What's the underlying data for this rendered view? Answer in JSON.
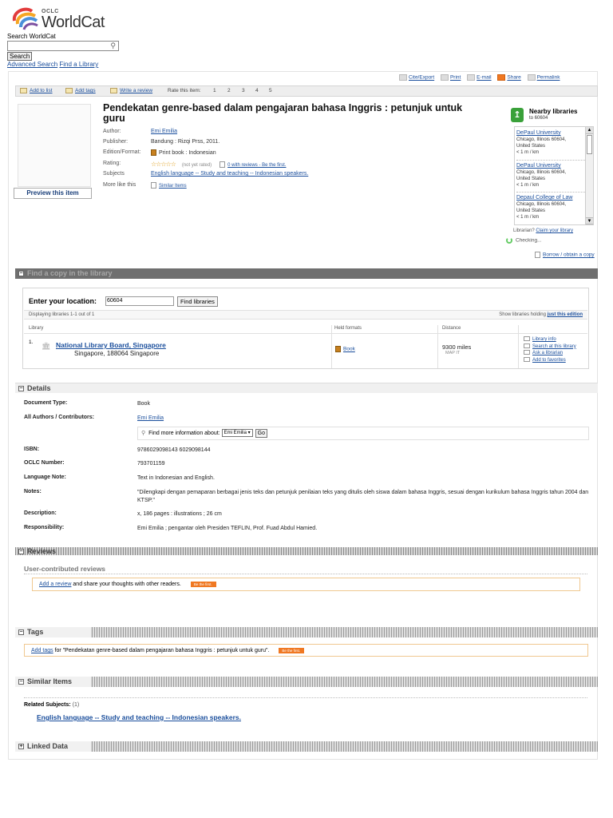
{
  "header": {
    "logo_oclc": "OCLC",
    "logo_text": "WorldCat",
    "search_label": "Search WorldCat",
    "search_value": "",
    "search_button": "Search",
    "advanced_search": "Advanced Search",
    "find_library": "Find a Library"
  },
  "topbar": {
    "cite": "Cite/Export",
    "print": "Print",
    "email": "E-mail",
    "share": "Share",
    "permalink": "Permalink"
  },
  "actionbar": {
    "add_to_list": "Add to list",
    "add_tags": "Add tags",
    "write_review": "Write a review",
    "rate_label": "Rate this item:",
    "ratings": [
      "1",
      "2",
      "3",
      "4",
      "5"
    ]
  },
  "record": {
    "preview": "Preview this item",
    "title": "Pendekatan genre-based dalam pengajaran bahasa Inggris : petunjuk untuk guru",
    "labels": {
      "author": "Author:",
      "publisher": "Publisher:",
      "edition": "Edition/Format:",
      "rating": "Rating:",
      "subjects": "Subjects",
      "more_like_this": "More like this"
    },
    "author": "Emi Emilia",
    "publisher": "Bandung : Rizqi Prss, 2011.",
    "edition": "Print book : Indonesian",
    "rating_text": "(not yet rated)",
    "reviews_link": "0 with reviews - Be the first.",
    "subject": "English language -- Study and teaching -- Indonesian speakers.",
    "similar_items": "Similar Items"
  },
  "nearby": {
    "title": "Nearby libraries",
    "subtitle": "to 60604",
    "libraries": [
      {
        "name": "DePaul University",
        "city": "Chicago, Illinois 60604,",
        "country": "United States",
        "distance": "< 1 m / km"
      },
      {
        "name": "DePaul University",
        "city": "Chicago, Illinois 60604,",
        "country": "United States",
        "distance": "< 1 m / km"
      },
      {
        "name": "Depaul College of Law",
        "city": "Chicago, Illinois 60604,",
        "country": "United States",
        "distance": "< 1 m / km"
      }
    ],
    "librarian_prefix": "Librarian?",
    "claim": "Claim your library",
    "checking": "Checking...",
    "borrow": "Borrow / obtain a copy"
  },
  "find_copy": {
    "header": "Find a copy in the library",
    "location_label": "Enter your location:",
    "location_value": "60604",
    "find_button": "Find libraries",
    "displaying": "Displaying libraries 1-1 out of 1",
    "show_prefix": "Show libraries holding",
    "show_link": "just this edition",
    "columns": {
      "library": "Library",
      "held": "Held formats",
      "distance": "Distance"
    },
    "row": {
      "index": "1.",
      "name": "National Library Board, Singapore",
      "address": "Singapore, 188064 Singapore",
      "format": "Book",
      "distance": "9300 miles",
      "map": "MAP IT",
      "actions": [
        "Library info",
        "Search at this library",
        "Ask a librarian",
        "Add to favorites"
      ]
    }
  },
  "details": {
    "header": "Details",
    "find_more_label": "Find more information about:",
    "find_more_value": "Emi Emilia",
    "go": "Go",
    "rows": [
      {
        "k": "Document Type:",
        "v": "Book"
      },
      {
        "k": "All Authors / Contributors:",
        "v": "Emi Emilia"
      },
      {
        "k": "ISBN:",
        "v": "9786029098143 6029098144"
      },
      {
        "k": "OCLC Number:",
        "v": "793701159"
      },
      {
        "k": "Language Note:",
        "v": "Text in Indonesian and English."
      },
      {
        "k": "Notes:",
        "v": "\"Dilengkapi dengan pemaparan berbagai jenis teks dan petunjuk penilaian teks yang ditulis oleh siswa dalam bahasa Inggris, sesuai dengan kurikulum bahasa Inggris tahun 2004 dan KTSP.\""
      },
      {
        "k": "Description:",
        "v": "x, 186 pages : illustrations ; 26 cm"
      },
      {
        "k": "Responsibility:",
        "v": "Emi Emilia ; pengantar oleh Presiden TEFLIN, Prof. Fuad Abdul Hamied."
      }
    ]
  },
  "reviews": {
    "header": "Reviews",
    "subhead": "User-contributed reviews",
    "add_link": "Add a review",
    "add_text": " and share your thoughts with other readers.",
    "badge": "Be the first."
  },
  "tags": {
    "header": "Tags",
    "add_link": "Add tags",
    "add_text": " for \"Pendekatan genre-based dalam pengajaran bahasa Inggris : petunjuk untuk guru\".",
    "badge": "Be the first."
  },
  "similar": {
    "header": "Similar Items",
    "related_label": "Related Subjects:",
    "related_count": "(1)",
    "subject": "English language -- Study and teaching -- Indonesian speakers."
  },
  "linked": {
    "header": "Linked Data"
  }
}
